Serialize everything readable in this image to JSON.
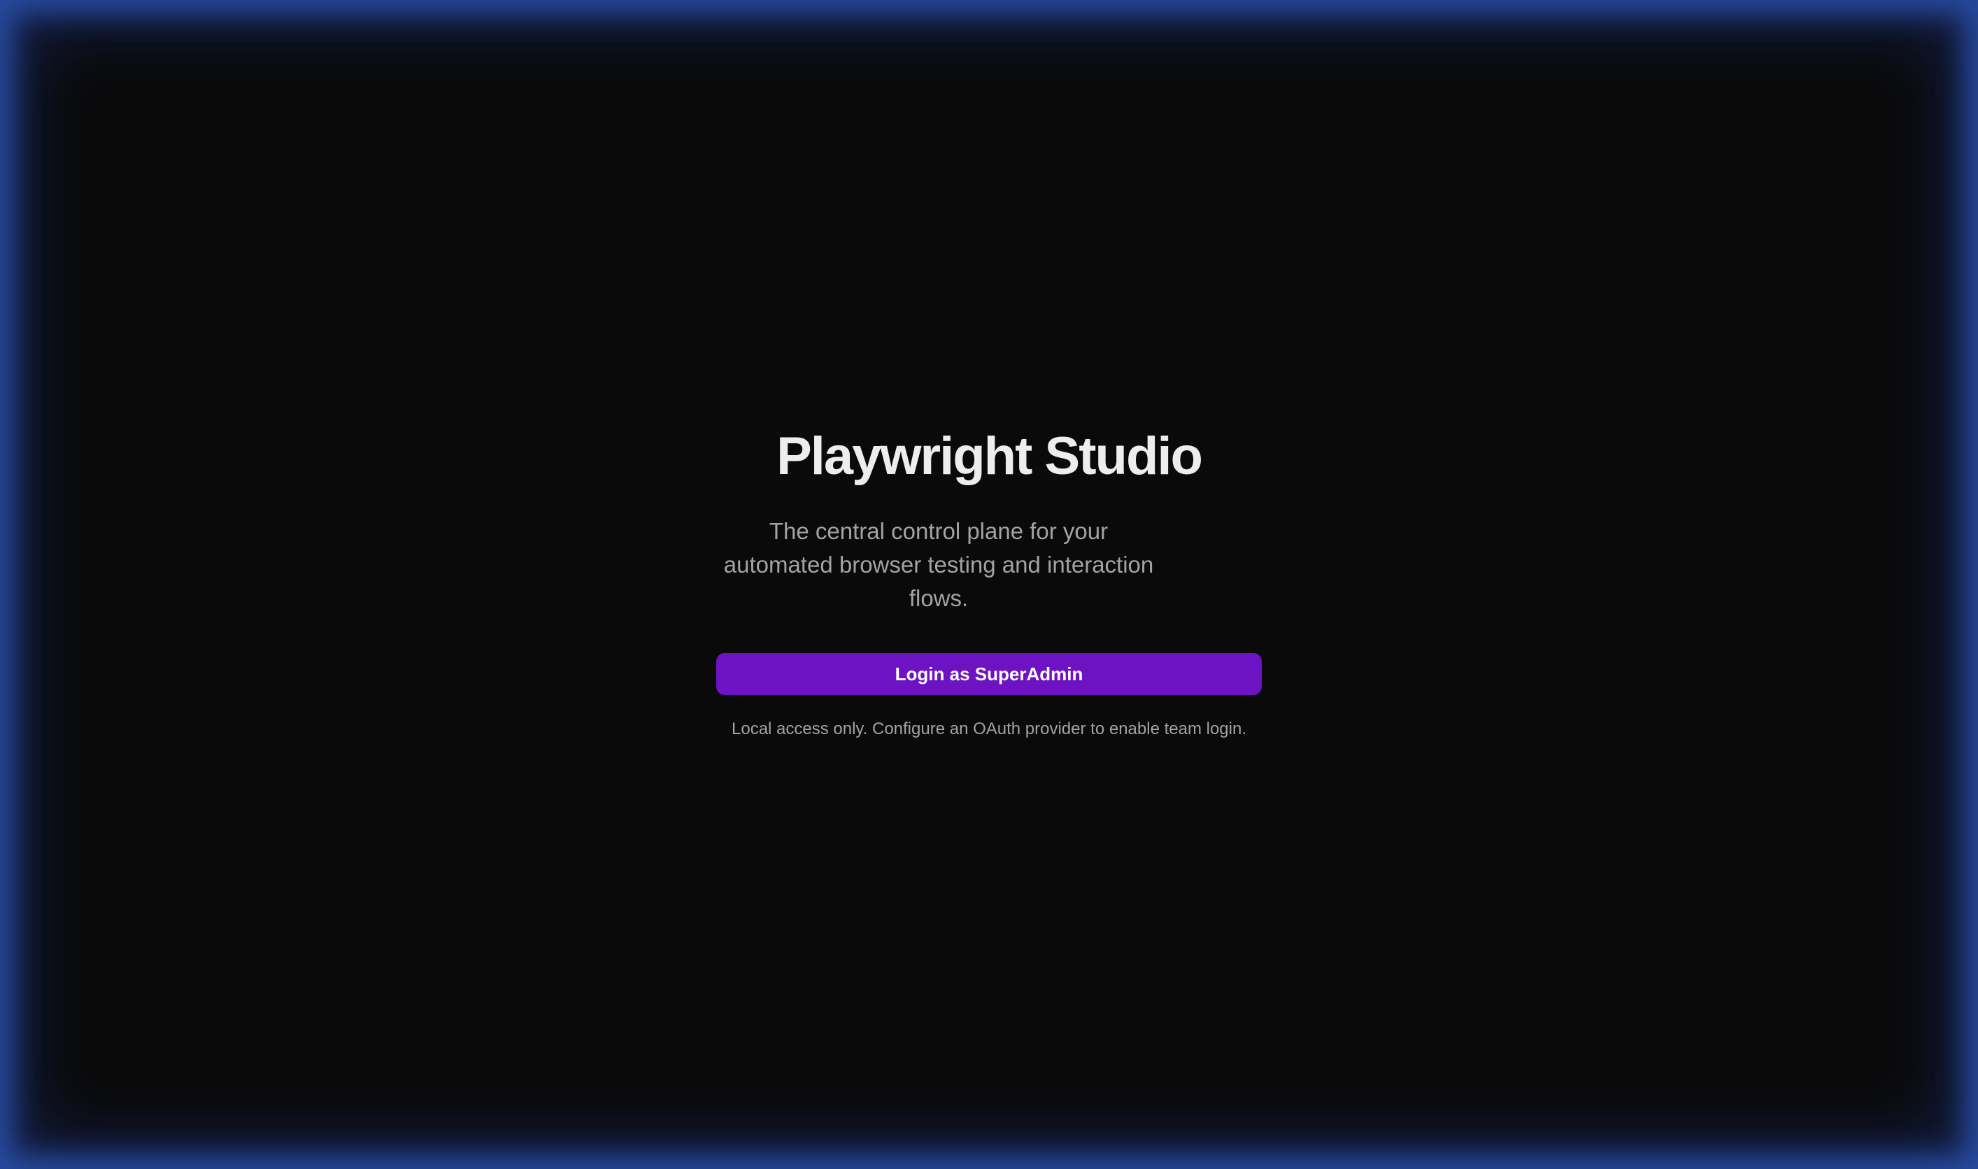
{
  "app": {
    "title": "Playwright Studio",
    "subtitle": "The central control plane for your automated browser testing and interaction flows."
  },
  "login": {
    "button_label": "Login as SuperAdmin",
    "note": "Local access only. Configure an OAuth provider to enable team login."
  },
  "colors": {
    "background": "#0a0a0a",
    "accent": "#6d13c4",
    "title_text": "#ededed",
    "muted_text": "#a3a3a3",
    "frame_glow": "#2b4fa6"
  }
}
